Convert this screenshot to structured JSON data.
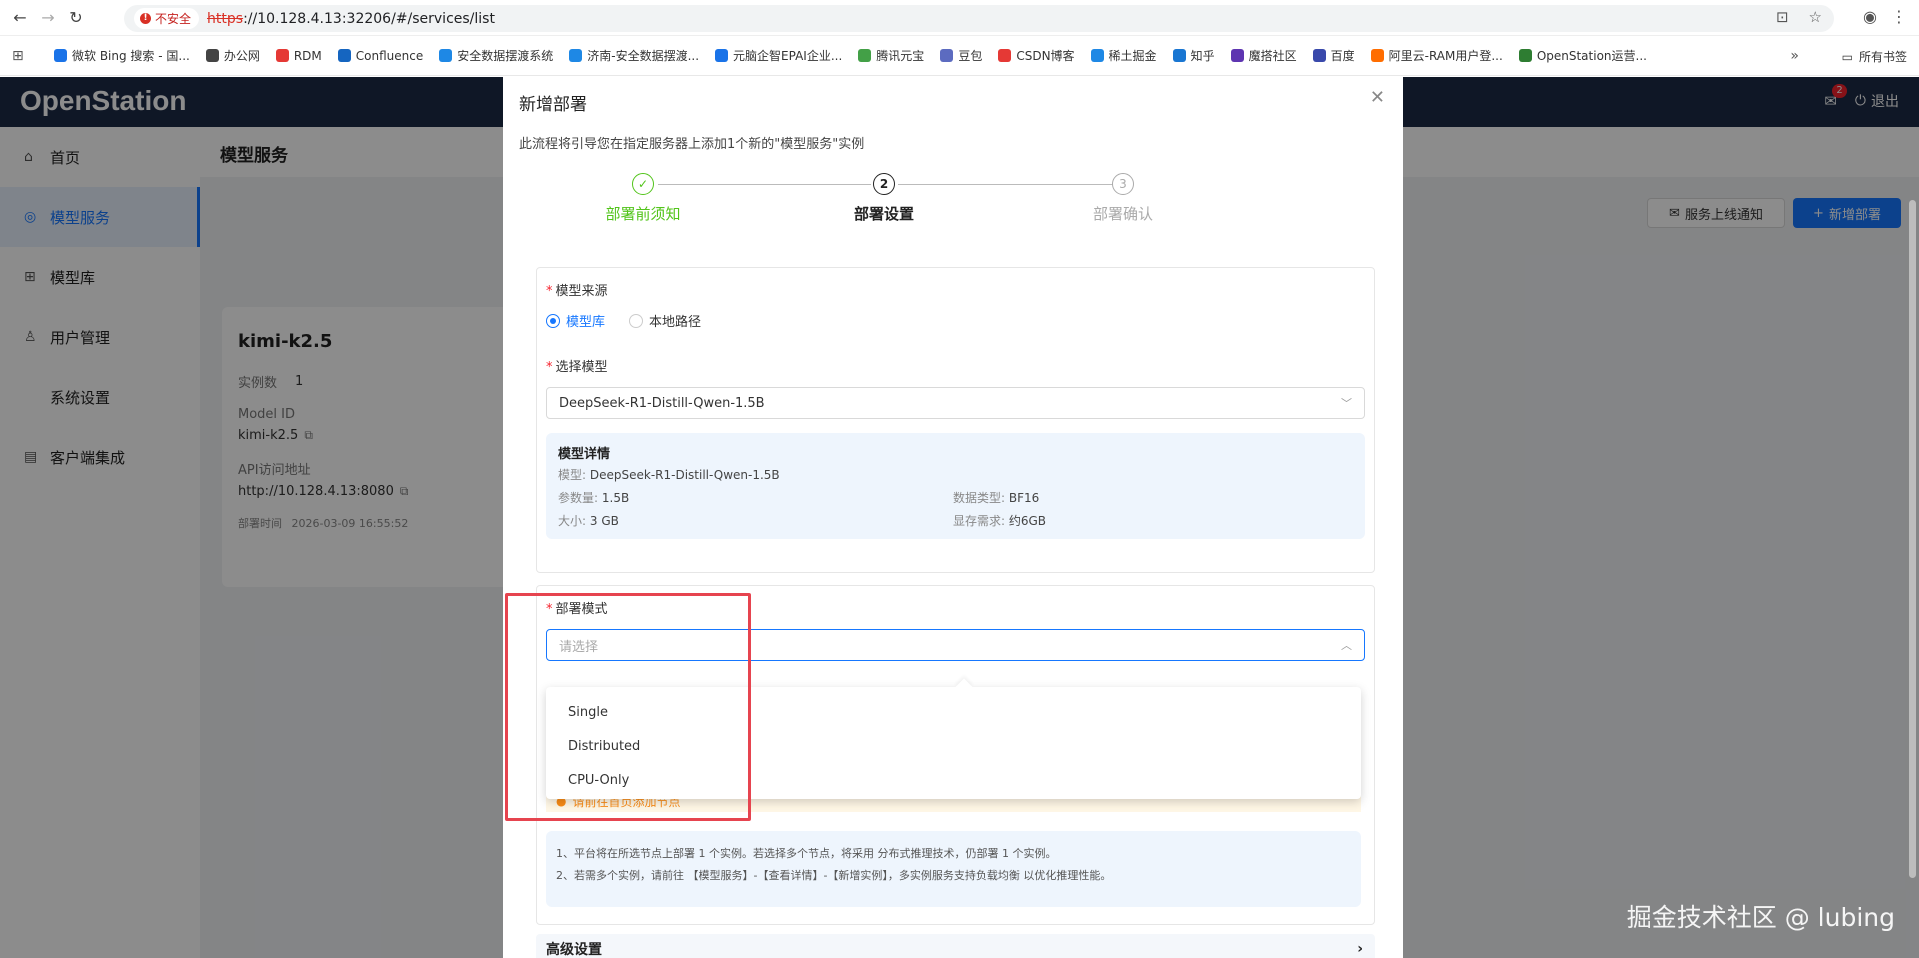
{
  "browser": {
    "insecure_label": "不安全",
    "url_protocol": "https",
    "url_rest": "://10.128.4.13:32206/#/services/list",
    "bookmarks": [
      {
        "label": "微软 Bing 搜索 - 国...",
        "color": "#1a73e8"
      },
      {
        "label": "办公网",
        "color": "#444444"
      },
      {
        "label": "RDM",
        "color": "#e53935"
      },
      {
        "label": "Confluence",
        "color": "#1565c0"
      },
      {
        "label": "安全数据摆渡系统",
        "color": "#1e88e5"
      },
      {
        "label": "济南-安全数据摆渡...",
        "color": "#1e88e5"
      },
      {
        "label": "元脑企智EPAI企业...",
        "color": "#1a73e8"
      },
      {
        "label": "腾讯元宝",
        "color": "#43a047"
      },
      {
        "label": "豆包",
        "color": "#5c6bc0"
      },
      {
        "label": "CSDN博客",
        "color": "#e53935"
      },
      {
        "label": "稀土掘金",
        "color": "#1e88e5"
      },
      {
        "label": "知乎",
        "color": "#1976d2"
      },
      {
        "label": "魔搭社区",
        "color": "#5e35b1"
      },
      {
        "label": "百度",
        "color": "#3949ab"
      },
      {
        "label": "阿里云-RAM用户登...",
        "color": "#ff6d00"
      },
      {
        "label": "OpenStation运营...",
        "color": "#2e7d32"
      }
    ],
    "bookmarks_more": "»",
    "all_bookmarks": "所有书签"
  },
  "app": {
    "logo": "OpenStation",
    "badge_count": "2",
    "logout": "退出"
  },
  "sidebar": {
    "items": [
      {
        "label": "首页",
        "icon": "home-icon",
        "glyph": "⌂"
      },
      {
        "label": "模型服务",
        "icon": "service-icon",
        "glyph": "◎"
      },
      {
        "label": "模型库",
        "icon": "model-library-icon",
        "glyph": "⊞"
      },
      {
        "label": "用户管理",
        "icon": "user-icon",
        "glyph": "♙"
      },
      {
        "label": "系统设置",
        "icon": "",
        "glyph": ""
      },
      {
        "label": "客户端集成",
        "icon": "client-icon",
        "glyph": "▤"
      }
    ]
  },
  "page": {
    "title": "模型服务",
    "notify_button": "服务上线通知",
    "new_button": "新增部署"
  },
  "service_card": {
    "name": "kimi-k2.5",
    "instances_label": "实例数",
    "instances_value": "1",
    "model_id_label": "Model ID",
    "model_id_value": "kimi-k2.5",
    "api_label": "API访问地址",
    "api_value": "http://10.128.4.13:8080",
    "deploy_time_label": "部署时间",
    "deploy_time_value": "2026-03-09 16:55:52"
  },
  "modal": {
    "title": "新增部署",
    "description": "此流程将引导您在指定服务器上添加1个新的\"模型服务\"实例",
    "steps": [
      {
        "num": "✓",
        "label": "部署前须知",
        "state": "done"
      },
      {
        "num": "2",
        "label": "部署设置",
        "state": "current"
      },
      {
        "num": "3",
        "label": "部署确认",
        "state": "todo"
      }
    ],
    "model_source_label": "模型来源",
    "source_options": [
      "模型库",
      "本地路径"
    ],
    "select_model_label": "选择模型",
    "selected_model": "DeepSeek-R1-Distill-Qwen-1.5B",
    "detail": {
      "title": "模型详情",
      "model_key": "模型:",
      "model_val": "DeepSeek-R1-Distill-Qwen-1.5B",
      "params_key": "参数量:",
      "params_val": "1.5B",
      "dtype_key": "数据类型:",
      "dtype_val": "BF16",
      "size_key": "大小:",
      "size_val": "3 GB",
      "vram_key": "显存需求:",
      "vram_val": "约6GB"
    },
    "deploy_mode_label": "部署模式",
    "deploy_mode_placeholder": "请选择",
    "deploy_mode_options": [
      "Single",
      "Distributed",
      "CPU-Only"
    ],
    "warning_text": "请前往首页添加节点",
    "tips": [
      "1、平台将在所选节点上部署 1 个实例。若选择多个节点，将采用 分布式推理技术，仍部署 1 个实例。",
      "2、若需多个实例，请前往 【模型服务】-【查看详情】-【新增实例】，多实例服务支持负载均衡 以优化推理性能。"
    ],
    "advanced_label": "高级设置"
  },
  "watermark": "掘金技术社区 @ lubing"
}
